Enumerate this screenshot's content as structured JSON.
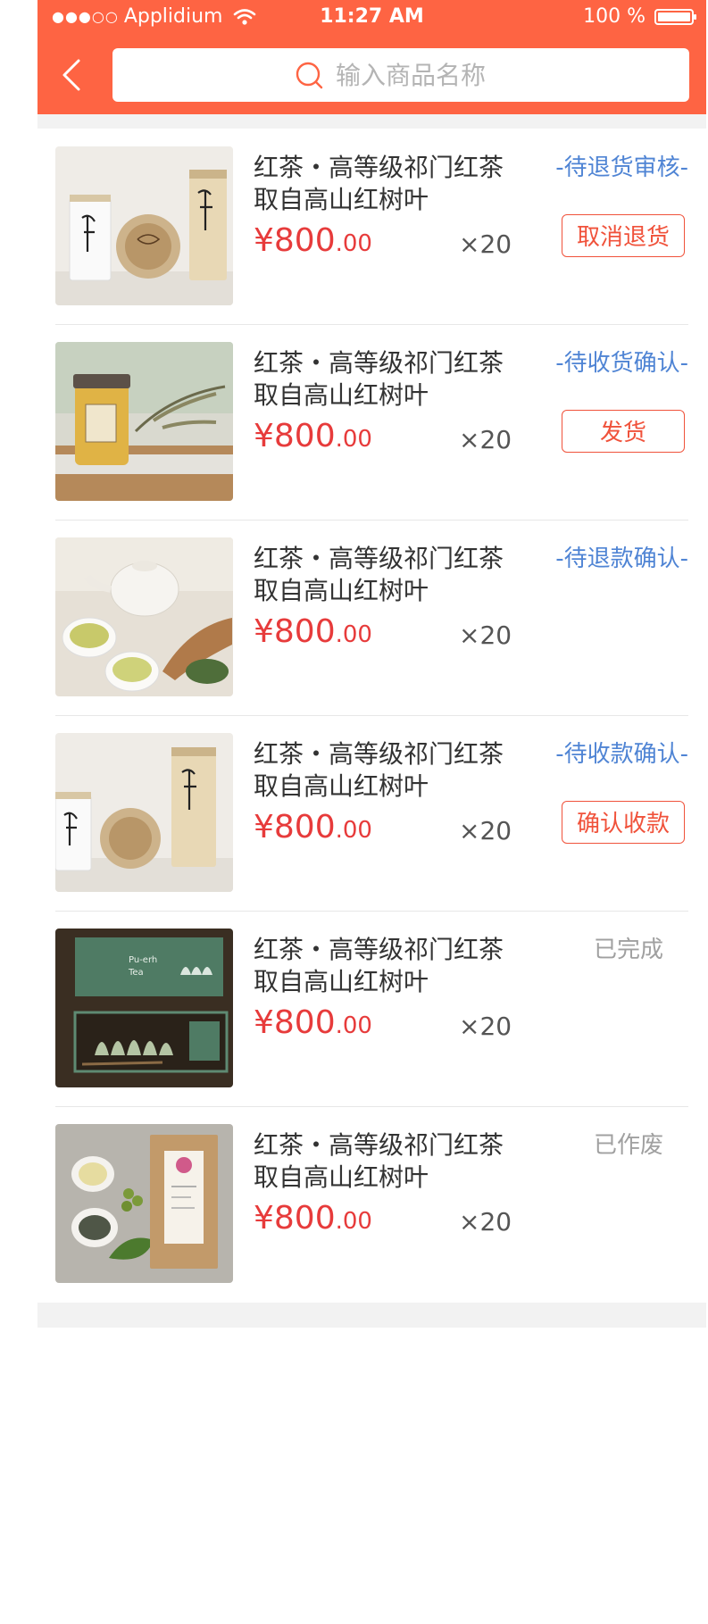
{
  "status_bar": {
    "carrier": "Applidium",
    "signal": "●●●○○",
    "time": "11:27 AM",
    "battery": "100 %"
  },
  "search": {
    "placeholder": "输入商品名称"
  },
  "colors": {
    "brand": "#fe6443",
    "price": "#e73b3b",
    "status_blue": "#4f84d4",
    "status_gray": "#a0a0a0",
    "button_border": "#f0523b"
  },
  "orders": [
    {
      "title_line1": "红茶・高等级祁门红茶",
      "title_line2": "取自高山红树叶",
      "price_main": "¥800",
      "price_cents": ".00",
      "qty": "×20",
      "status": "-待退货审核-",
      "action": "取消退货",
      "image": "tea-canisters-image"
    },
    {
      "title_line1": "红茶・高等级祁门红茶",
      "title_line2": "取自高山红树叶",
      "price_main": "¥800",
      "price_cents": ".00",
      "qty": "×20",
      "status": "-待收货确认-",
      "action": "发货",
      "image": "honey-jar-image"
    },
    {
      "title_line1": "红茶・高等级祁门红茶",
      "title_line2": "取自高山红树叶",
      "price_main": "¥800",
      "price_cents": ".00",
      "qty": "×20",
      "status": "-待退款确认-",
      "action": "",
      "image": "teapot-cups-image"
    },
    {
      "title_line1": "红茶・高等级祁门红茶",
      "title_line2": "取自高山红树叶",
      "price_main": "¥800",
      "price_cents": ".00",
      "qty": "×20",
      "status": "-待收款确认-",
      "action": "确认收款",
      "image": "tea-canisters-image"
    },
    {
      "title_line1": "红茶・高等级祁门红茶",
      "title_line2": "取自高山红树叶",
      "price_main": "¥800",
      "price_cents": ".00",
      "qty": "×20",
      "status": "已完成",
      "action": "",
      "image": "puerh-tea-box-image",
      "box_text": [
        "Pu-erh",
        "Tea"
      ]
    },
    {
      "title_line1": "红茶・高等级祁门红茶",
      "title_line2": "取自高山红树叶",
      "price_main": "¥800",
      "price_cents": ".00",
      "qty": "×20",
      "status": "已作废",
      "action": "",
      "image": "kraft-tea-bag-image"
    }
  ]
}
